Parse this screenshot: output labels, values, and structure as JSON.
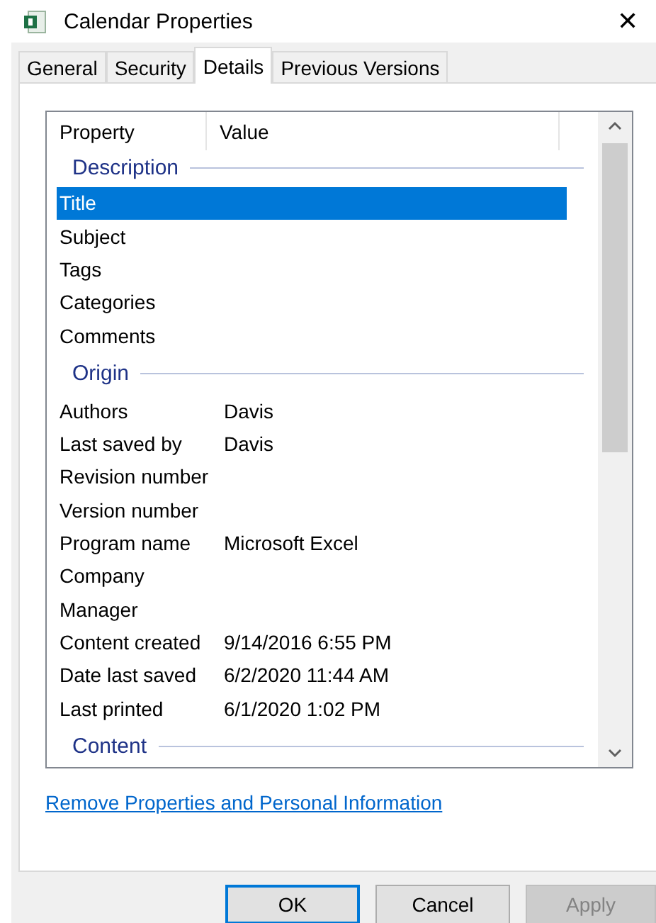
{
  "window": {
    "title": "Calendar Properties",
    "close": "✕"
  },
  "tabs": [
    {
      "label": "General",
      "selected": false
    },
    {
      "label": "Security",
      "selected": false
    },
    {
      "label": "Details",
      "selected": true
    },
    {
      "label": "Previous Versions",
      "selected": false
    }
  ],
  "table": {
    "columns": [
      "Property",
      "Value"
    ],
    "groups": [
      {
        "name": "Description",
        "rows": [
          {
            "property": "Title",
            "selected": true
          },
          {
            "property": "Subject",
            "selected": false
          },
          {
            "property": "Tags",
            "selected": false
          },
          {
            "property": "Categories",
            "selected": false
          },
          {
            "property": "Comments",
            "selected": false
          }
        ]
      },
      {
        "name": "Origin",
        "rows": [
          {
            "property": "Authors",
            "value": "Davis",
            "selected": false
          },
          {
            "property": "Last saved by",
            "value": "Davis",
            "selected": false
          },
          {
            "property": "Revision number",
            "selected": false
          },
          {
            "property": "Version number",
            "selected": false
          },
          {
            "property": "Program name",
            "value": "Microsoft Excel",
            "selected": false
          },
          {
            "property": "Company",
            "selected": false
          },
          {
            "property": "Manager",
            "selected": false
          },
          {
            "property": "Content created",
            "value": "9/14/2016 6:55 PM",
            "selected": false
          },
          {
            "property": "Date last saved",
            "value": "6/2/2020 11:44 AM",
            "selected": false
          },
          {
            "property": "Last printed",
            "value": "6/1/2020 1:02 PM",
            "selected": false
          }
        ]
      },
      {
        "name": "Content"
      }
    ]
  },
  "link": "Remove Properties and Personal Information",
  "buttons": [
    {
      "label": "OK",
      "default": true,
      "disabled": false
    },
    {
      "label": "Cancel",
      "default": false,
      "disabled": false
    },
    {
      "label": "Apply",
      "default": false,
      "disabled": true
    }
  ]
}
